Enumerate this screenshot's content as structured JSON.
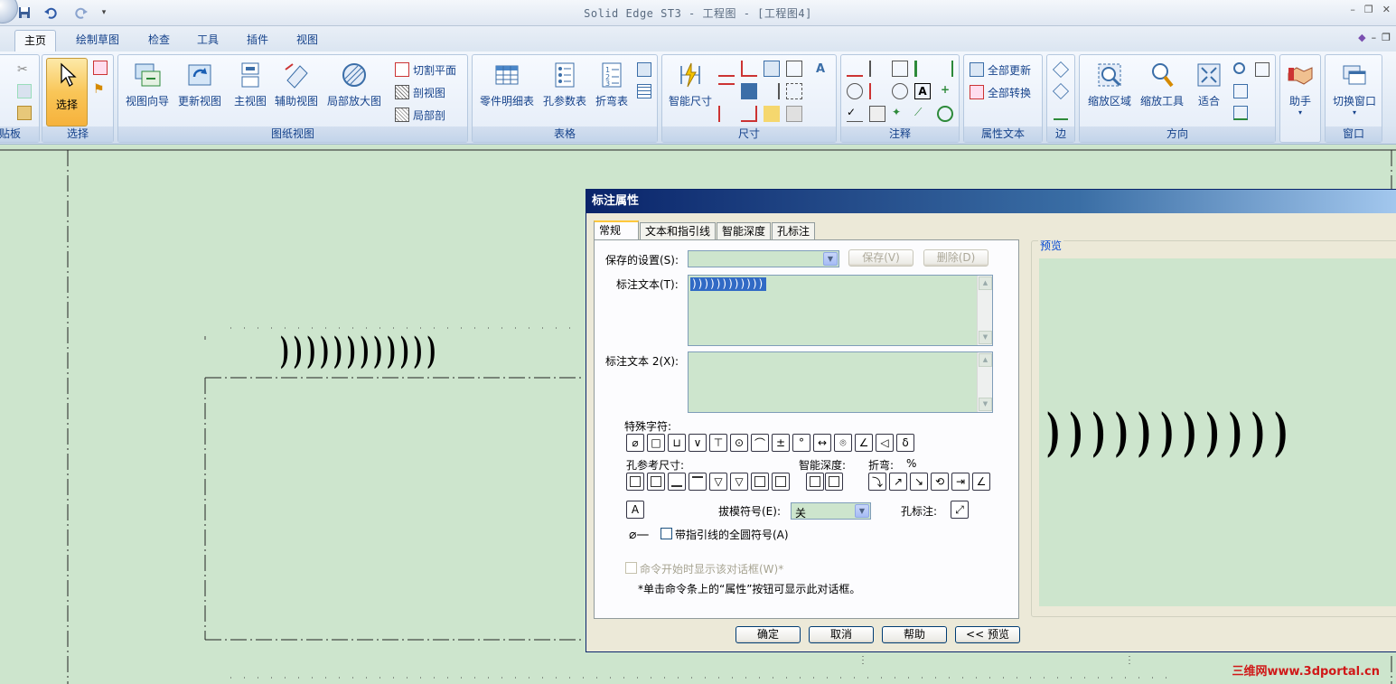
{
  "window": {
    "title": "Solid Edge ST3 - 工程图 - [工程图4]"
  },
  "tabs": [
    {
      "label": "主页",
      "active": true
    },
    {
      "label": "绘制草图"
    },
    {
      "label": "检查"
    },
    {
      "label": "工具"
    },
    {
      "label": "插件"
    },
    {
      "label": "视图"
    }
  ],
  "ribbon": {
    "clipboard_label": "贴板",
    "select_group": {
      "label": "选择",
      "select_btn": "选择"
    },
    "drawing_views": {
      "label": "图纸视图",
      "view_wizard": "视图向导",
      "update_view": "更新视图",
      "main_view": "主视图",
      "aux_view": "辅助视图",
      "detail_view": "局部放大图",
      "cutting_plane": "切割平面",
      "section_view": "剖视图",
      "broken_out": "局部剖"
    },
    "tables": {
      "label": "表格",
      "parts_list": "零件明细表",
      "hole_table": "孔参数表",
      "bend_table": "折弯表"
    },
    "dimension": {
      "label": "尺寸",
      "smart_dim": "智能尺寸"
    },
    "annotation": {
      "label": "注释"
    },
    "property_text": {
      "label": "属性文本",
      "update_all": "全部更新",
      "convert_all": "全部转换"
    },
    "edge": {
      "label": "边"
    },
    "orient": {
      "label": "方向",
      "zoom_area": "缩放区域",
      "zoom_tool": "缩放工具",
      "fit": "适合"
    },
    "assistant": {
      "label": "助手"
    },
    "window": {
      "label": "窗口",
      "switch": "切换窗口"
    }
  },
  "canvas": {
    "annotation_text": ") ) ) ) ) ) ) ) ) ) ) )"
  },
  "dialog": {
    "title": "标注属性",
    "tabs": [
      "常规",
      "文本和指引线",
      "智能深度",
      "孔标注"
    ],
    "saved_settings_label": "保存的设置(S):",
    "save_btn": "保存(V)",
    "delete_btn": "删除(D)",
    "callout_text_label": "标注文本(T):",
    "callout_text_value": "))))))))))))",
    "callout_text2_label": "标注文本 2(X):",
    "special_chars_label": "特殊字符:",
    "special_chars": [
      "⌀",
      "□",
      "⊔",
      "∨",
      "⊤",
      "⊙",
      "⌒",
      "±",
      "°",
      "↔",
      "⌾",
      "∠",
      "◁",
      "δ"
    ],
    "hole_ref_label": "孔参考尺寸:",
    "smart_depth_label": "智能深度:",
    "bend_label": "折弯:",
    "bend_pct": "%",
    "draft_symbol_label": "拔模符号(E):",
    "draft_symbol_value": "关",
    "hole_callout_label": "孔标注:",
    "all_around_label": "带指引线的全圆符号(A)",
    "show_dialog_label": "命令开始时显示该对话框(W)*",
    "note": "*单击命令条上的“属性”按钮可显示此对话框。",
    "preview_label": "预览",
    "preview_text": ") ) ) ) ) ) ) ) ) ) )",
    "buttons": {
      "ok": "确定",
      "cancel": "取消",
      "help": "帮助",
      "preview": "<< 预览"
    }
  },
  "watermark": "三维网www.3dportal.cn"
}
